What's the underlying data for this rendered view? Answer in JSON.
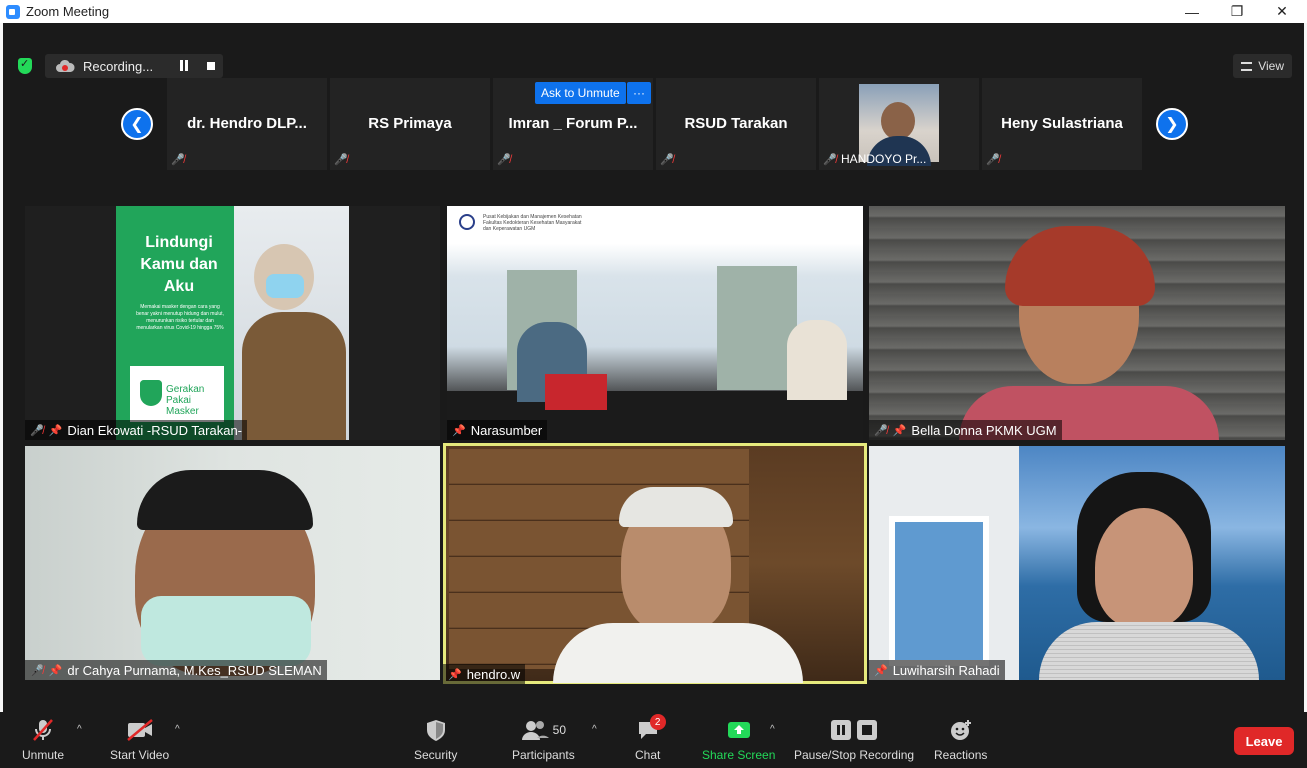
{
  "window": {
    "title": "Zoom Meeting"
  },
  "top_bar": {
    "recording_text": "Recording...",
    "view_label": "View"
  },
  "strip": {
    "tiles": [
      {
        "name": "dr. Hendro DLP..."
      },
      {
        "name": "RS Primaya"
      },
      {
        "name": "Imran _ Forum P..."
      },
      {
        "name": "RSUD Tarakan"
      },
      {
        "name": "HANDOYO Pr..."
      },
      {
        "name": "Heny Sulastriana"
      }
    ],
    "ask_to_unmute": "Ask to Unmute",
    "more": "···"
  },
  "gallery": {
    "tiles": [
      {
        "name": "Dian Ekowati -RSUD Tarakan-",
        "poster_title": "Lindungi Kamu dan Aku",
        "poster_text": "Memakai masker dengan cara yang benar yakni menutup hidung dan mulut, menurunkan risiko tertular dan menularkan virus Covid-19 hingga 75%",
        "poster_logo": "Gerakan Pakai Masker"
      },
      {
        "name": "Narasumber",
        "banner_line1": "Pusat Kebijakan dan Manajemen Kesehatan",
        "banner_line2": "Fakultas Kedokteran Kesehatan Masyarakat",
        "banner_line3": "dan Keperawatan UGM"
      },
      {
        "name": "Bella Donna PKMK UGM"
      },
      {
        "name": "dr Cahya Purnama, M.Kes_RSUD SLEMAN"
      },
      {
        "name": "hendro.w"
      },
      {
        "name": "Luwiharsih Rahadi"
      }
    ]
  },
  "toolbar": {
    "unmute": "Unmute",
    "start_video": "Start Video",
    "security": "Security",
    "participants": "Participants",
    "participants_count": "50",
    "chat": "Chat",
    "chat_badge": "2",
    "share_screen": "Share Screen",
    "pause_stop": "Pause/Stop Recording",
    "reactions": "Reactions",
    "leave": "Leave"
  },
  "colors": {
    "accent_blue": "#0e72ed",
    "leave_red": "#e02828",
    "share_green": "#23d959",
    "active_outline": "#e6ea7d"
  }
}
